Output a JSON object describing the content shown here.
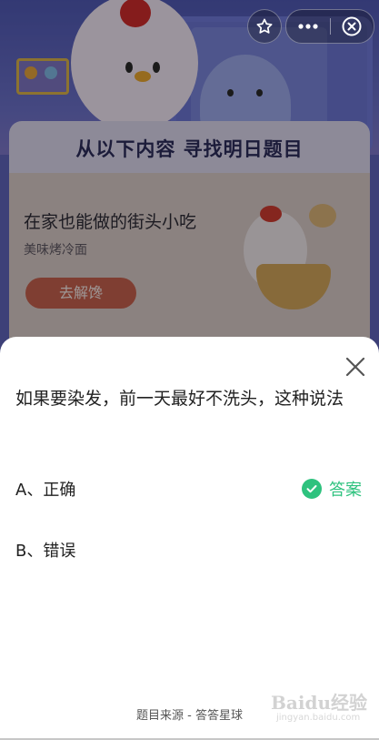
{
  "background": {
    "banner_title": "从以下内容  寻找明日题目",
    "card": {
      "title": "在家也能做的街头小吃",
      "subtitle": "美味烤冷面",
      "button_label": "去解馋"
    }
  },
  "capsule": {
    "star_icon": "star-icon",
    "more_icon": "more-dots-icon",
    "close_icon": "close-circle-icon"
  },
  "sheet": {
    "question": "如果要染发，前一天最好不洗头，这种说法",
    "options": [
      {
        "label": "A、正确",
        "is_answer": true
      },
      {
        "label": "B、错误",
        "is_answer": false
      }
    ],
    "answer_label": "答案",
    "source": "题目来源 - 答答星球"
  },
  "watermark": {
    "brand": "Baidu经验",
    "url": "jingyan.baidu.com"
  },
  "colors": {
    "accent": "#2ec27e",
    "background_header": "#5f63b8"
  }
}
